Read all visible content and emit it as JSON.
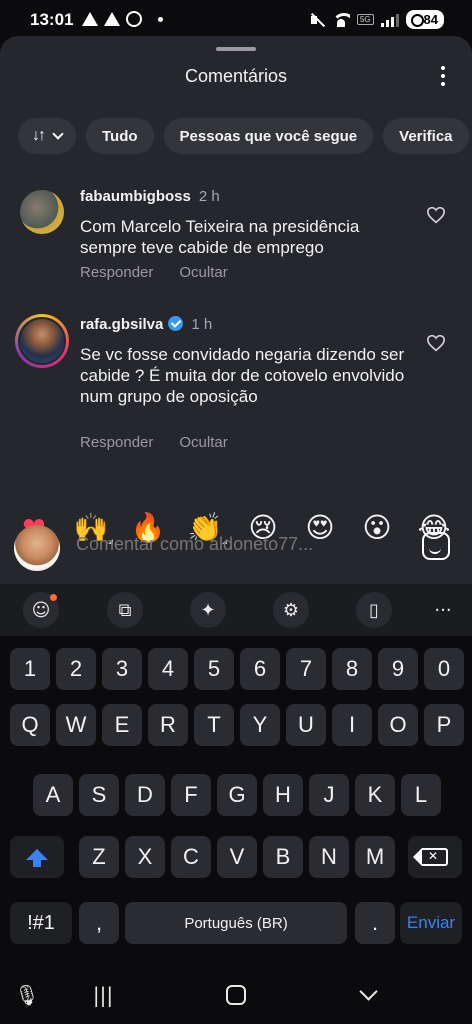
{
  "status_bar": {
    "time": "13:01",
    "battery": "84",
    "network": "5G"
  },
  "sheet": {
    "title": "Comentários",
    "filters": [
      "Tudo",
      "Pessoas que você segue",
      "Verifica"
    ]
  },
  "comments": [
    {
      "username": "fabaumbigboss",
      "time": "2 h",
      "text": "Com Marcelo Teixeira na presidência sempre teve cabide de emprego",
      "reply_label": "Responder",
      "hide_label": "Ocultar",
      "verified": false
    },
    {
      "username": "rafa.gbsilva",
      "time": "1 h",
      "text": "Se vc fosse convidado negaria dizendo ser cabide ? É muita dor de cotovelo envolvido num grupo de oposição",
      "reply_label": "Responder",
      "hide_label": "Ocultar",
      "verified": true
    }
  ],
  "reactions": [
    "❤",
    "🙌",
    "🔥",
    "👏",
    "😢",
    "😍",
    "😮",
    "😂"
  ],
  "compose": {
    "placeholder": "Comentar como aldoneto77..."
  },
  "keyboard": {
    "numbers": [
      "1",
      "2",
      "3",
      "4",
      "5",
      "6",
      "7",
      "8",
      "9",
      "0"
    ],
    "row1": [
      "Q",
      "W",
      "E",
      "R",
      "T",
      "Y",
      "U",
      "I",
      "O",
      "P"
    ],
    "row2": [
      "A",
      "S",
      "D",
      "F",
      "G",
      "H",
      "J",
      "K",
      "L"
    ],
    "row3": [
      "Z",
      "X",
      "C",
      "V",
      "B",
      "N",
      "M"
    ],
    "symbols_label": "!#1",
    "comma": ",",
    "space_label": "Português (BR)",
    "period": ".",
    "send_label": "Enviar"
  },
  "colors": {
    "sheet_bg": "#25272c",
    "accent_blue": "#3b82f6",
    "verified_blue": "#3897f0"
  }
}
